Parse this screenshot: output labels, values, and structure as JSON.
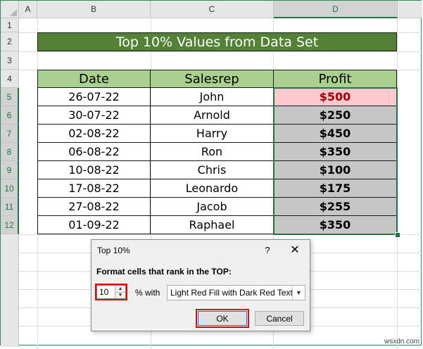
{
  "columns": [
    "A",
    "B",
    "C",
    "D"
  ],
  "rows": [
    "1",
    "2",
    "3",
    "4",
    "5",
    "6",
    "7",
    "8",
    "9",
    "10",
    "11",
    "12"
  ],
  "sheet": {
    "title": "Top 10% Values from Data Set",
    "headers": {
      "date": "Date",
      "salesrep": "Salesrep",
      "profit": "Profit"
    },
    "data": [
      {
        "date": "26-07-22",
        "salesrep": "John",
        "profit": "$500"
      },
      {
        "date": "30-07-22",
        "salesrep": "Arnold",
        "profit": "$250"
      },
      {
        "date": "02-08-22",
        "salesrep": "Harry",
        "profit": "$450"
      },
      {
        "date": "06-08-22",
        "salesrep": "Ron",
        "profit": "$350"
      },
      {
        "date": "10-08-22",
        "salesrep": "Chris",
        "profit": "$100"
      },
      {
        "date": "17-08-22",
        "salesrep": "Leonardo",
        "profit": "$175"
      },
      {
        "date": "27-08-22",
        "salesrep": "Jacob",
        "profit": "$255"
      },
      {
        "date": "01-09-22",
        "salesrep": "Raphael",
        "profit": "$350"
      }
    ]
  },
  "dialog": {
    "title": "Top 10%",
    "help": "?",
    "close": "✕",
    "prompt": "Format cells that rank in the TOP:",
    "value": "10",
    "pct_with": "% with",
    "format_option": "Light Red Fill with Dark Red Text",
    "ok": "OK",
    "cancel": "Cancel"
  },
  "colors": {
    "title_fill": "#538135",
    "header_fill": "#a9d08e",
    "top_fill": "#ffc7ce",
    "top_text": "#9c0006",
    "selection": "#217346",
    "highlight": "#e00000"
  },
  "watermark": "wsxdn.com"
}
